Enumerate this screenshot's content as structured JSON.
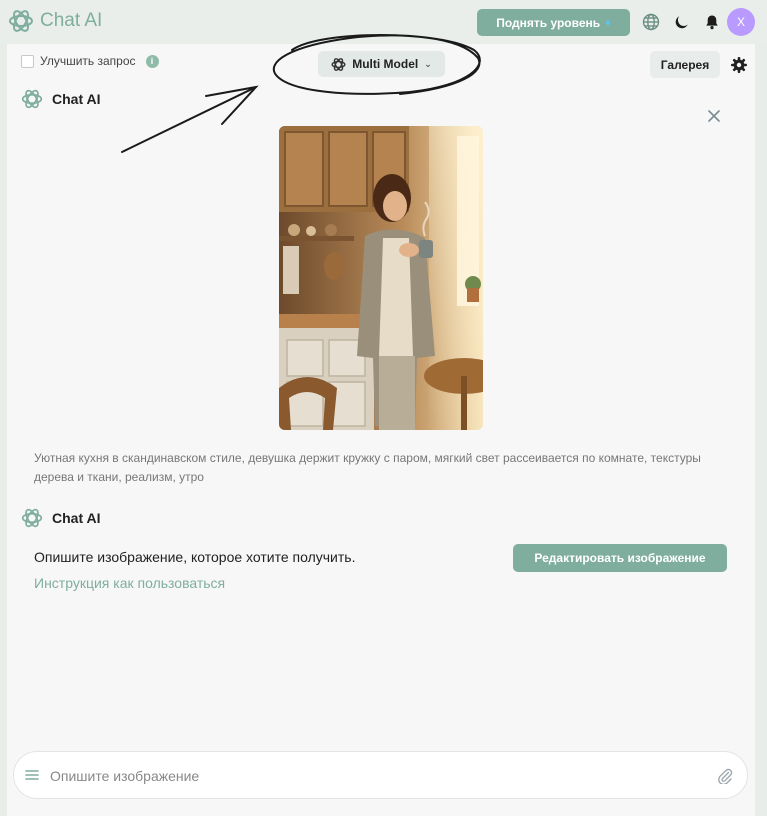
{
  "header": {
    "logo_text": "Chat AI",
    "upgrade_label": "Поднять уровень",
    "avatar_letter": "X"
  },
  "toolbar": {
    "enhance_label": "Улучшить запрос",
    "info_glyph": "i",
    "model_label": "Multi Model",
    "gallery_label": "Галерея"
  },
  "chat": {
    "sender_name": "Chat AI",
    "image_prompt": "Уютная кухня в скандинавском стиле, девушка держит кружку с паром, мягкий свет рассеивается по комнате, текстуры дерева и ткани, реализм, утро",
    "reply_text": "Опишите изображение, которое хотите получить.",
    "help_link": "Инструкция как пользоваться",
    "edit_label": "Редактировать изображение"
  },
  "composer": {
    "placeholder": "Опишите изображение"
  },
  "colors": {
    "accent": "#7fae9f",
    "avatar": "#b99bff",
    "panel": "#f7f7f7"
  },
  "icons": [
    "openai-logo-icon",
    "gem-icon",
    "globe-icon",
    "moon-icon",
    "bell-icon",
    "info-icon",
    "chevron-down-icon",
    "gear-icon",
    "close-icon",
    "menu-icon",
    "paperclip-icon"
  ]
}
